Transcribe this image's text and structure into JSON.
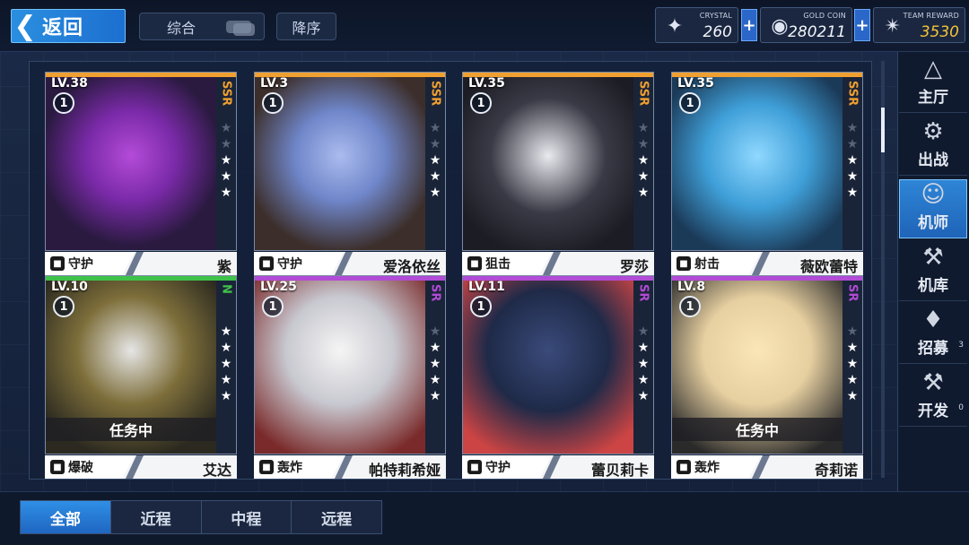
{
  "header": {
    "back_label": "返回",
    "sort_label": "综合",
    "order_label": "降序"
  },
  "resources": [
    {
      "name": "CRYSTAL",
      "value": "260",
      "icon": "crystal-icon"
    },
    {
      "name": "GOLD COIN",
      "value": "280211",
      "icon": "gold-coin-icon"
    },
    {
      "name": "TEAM REWARD",
      "value": "3530",
      "icon": "team-reward-star-icon"
    }
  ],
  "colors": {
    "ssr": "#f0a030",
    "n": "#3fc24a",
    "sr": "#b24bd6",
    "accent": "#2a8fe0",
    "reward": "#f2c33a"
  },
  "cards": [
    {
      "level": "LV.38",
      "rarity": "SSR",
      "stars": 3,
      "position": "1",
      "class": "守护",
      "class_icon": "shield-icon",
      "name": "紫",
      "status": ""
    },
    {
      "level": "LV.3",
      "rarity": "SSR",
      "stars": 3,
      "position": "1",
      "class": "守护",
      "class_icon": "shield-icon",
      "name": "爱洛依丝",
      "status": ""
    },
    {
      "level": "LV.35",
      "rarity": "SSR",
      "stars": 3,
      "position": "1",
      "class": "狙击",
      "class_icon": "sniper-rifle-icon",
      "name": "罗莎",
      "status": ""
    },
    {
      "level": "LV.35",
      "rarity": "SSR",
      "stars": 3,
      "position": "1",
      "class": "射击",
      "class_icon": "rifle-icon",
      "name": "薇欧蕾特",
      "status": ""
    },
    {
      "level": "LV.10",
      "rarity": "N",
      "stars": 5,
      "position": "1",
      "class": "爆破",
      "class_icon": "rocket-launcher-icon",
      "name": "艾达",
      "status": "任务中"
    },
    {
      "level": "LV.25",
      "rarity": "SR",
      "stars": 4,
      "position": "1",
      "class": "轰炸",
      "class_icon": "mortar-icon",
      "name": "帕特莉希娅",
      "status": ""
    },
    {
      "level": "LV.11",
      "rarity": "SR",
      "stars": 4,
      "position": "1",
      "class": "守护",
      "class_icon": "shield-icon",
      "name": "蕾贝莉卡",
      "status": ""
    },
    {
      "level": "LV.8",
      "rarity": "SR",
      "stars": 4,
      "position": "1",
      "class": "轰炸",
      "class_icon": "mortar-icon",
      "name": "奇莉诺",
      "status": "任务中"
    }
  ],
  "nav": [
    {
      "label": "主厅",
      "icon": "hall-icon"
    },
    {
      "label": "出战",
      "icon": "battle-tank-icon"
    },
    {
      "label": "机师",
      "icon": "pilot-portrait-icon",
      "active": true
    },
    {
      "label": "机库",
      "icon": "mech-hangar-icon"
    },
    {
      "label": "招募",
      "icon": "recruit-card-icon",
      "badge": "3"
    },
    {
      "label": "开发",
      "icon": "develop-wrench-icon",
      "badge": "0"
    }
  ],
  "tabs": [
    "全部",
    "近程",
    "中程",
    "远程"
  ]
}
